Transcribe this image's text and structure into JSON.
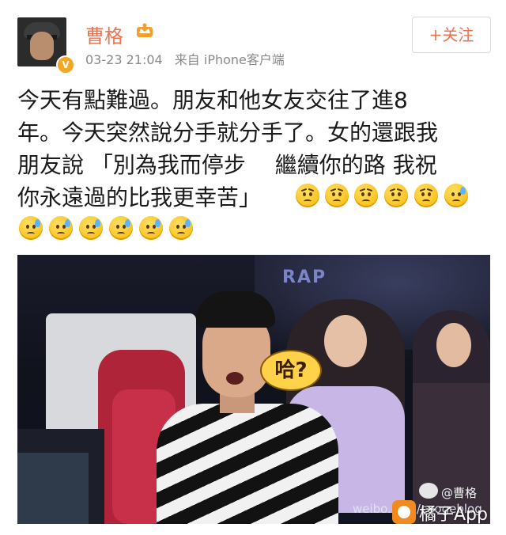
{
  "post": {
    "user_name": "曹格",
    "time": "03-23 21:04",
    "source": "来自 iPhone客户端",
    "follow_label": "+关注",
    "verified_badge": "V",
    "text_lines": [
      "今天有點難過。朋友和他女友交往了進8",
      "年。今天突然說分手就分手了。女的還跟我",
      "朋友說 「別為我而停步　 繼續你的路 我祝",
      "你永遠過的比我更幸苦」"
    ],
    "emoji_line1": [
      "sad-emoji",
      "sad-emoji",
      "sad-emoji",
      "sad-emoji",
      "sad-emoji",
      "sweat-emoji"
    ],
    "emoji_line2": [
      "sweat-emoji",
      "sweat-emoji",
      "sweat-emoji",
      "sweat-emoji",
      "sweat-emoji",
      "sweat-emoji"
    ]
  },
  "image": {
    "bubble_text": "哈?",
    "rap_text": "RAP",
    "watermark_handle": "@曹格",
    "watermark_site": "weibo.com/caogeblog"
  },
  "app_watermark": {
    "label": "橘子App"
  },
  "colors": {
    "accent": "#eb7350",
    "meta": "#8a8a8a",
    "app_orange": "#f28a1e"
  }
}
